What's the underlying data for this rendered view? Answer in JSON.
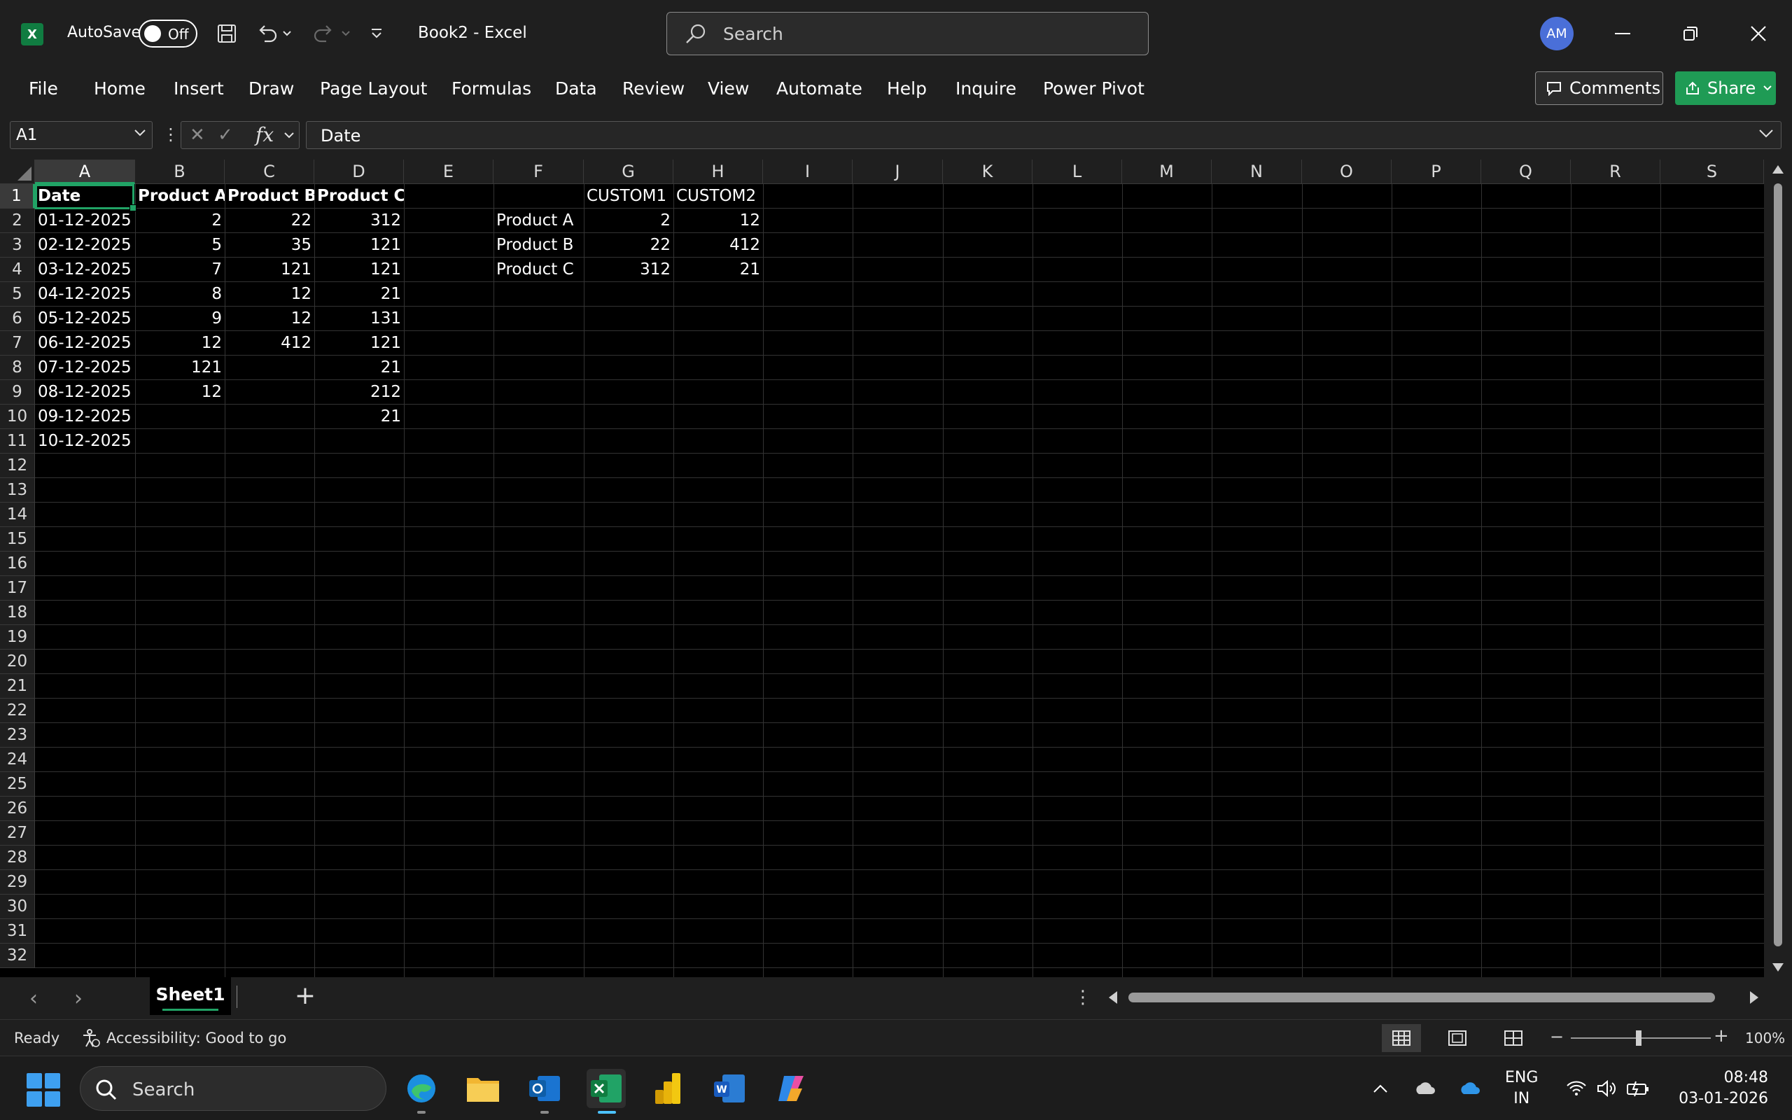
{
  "app": {
    "logo_letter": "X",
    "autosave_label": "AutoSave",
    "autosave_state": "Off",
    "doc_title": "Book2  -  Excel",
    "search_placeholder": "Search",
    "avatar_initials": "AM",
    "accent": "#21a366"
  },
  "menu": {
    "items": [
      "File",
      "Home",
      "Insert",
      "Draw",
      "Page Layout",
      "Formulas",
      "Data",
      "Review",
      "View",
      "Automate",
      "Help",
      "Inquire",
      "Power Pivot"
    ],
    "comments_label": "Comments",
    "share_label": "Share"
  },
  "formula_bar": {
    "name_box": "A1",
    "fx_label": "fx",
    "content": "Date"
  },
  "grid": {
    "columns": [
      "A",
      "B",
      "C",
      "D",
      "E",
      "F",
      "G",
      "H",
      "I",
      "J",
      "K",
      "L",
      "M",
      "N",
      "O",
      "P",
      "Q",
      "R",
      "S"
    ],
    "rows": [
      "1",
      "2",
      "3",
      "4",
      "5",
      "6",
      "7",
      "8",
      "9",
      "10",
      "11",
      "12",
      "13",
      "14",
      "15",
      "16",
      "17",
      "18",
      "19",
      "20",
      "21",
      "22",
      "23",
      "24",
      "25",
      "26",
      "27",
      "28",
      "29",
      "30",
      "31",
      "32"
    ],
    "selected_column": "A",
    "selected_row": "1",
    "table1_headers": [
      "Date",
      "Product A",
      "Product B",
      "Product C"
    ],
    "table1_rows": [
      [
        "01-12-2025",
        "2",
        "22",
        "312"
      ],
      [
        "02-12-2025",
        "5",
        "35",
        "121"
      ],
      [
        "03-12-2025",
        "7",
        "121",
        "121"
      ],
      [
        "04-12-2025",
        "8",
        "12",
        "21"
      ],
      [
        "05-12-2025",
        "9",
        "12",
        "131"
      ],
      [
        "06-12-2025",
        "12",
        "412",
        "121"
      ],
      [
        "07-12-2025",
        "121",
        "",
        "21"
      ],
      [
        "08-12-2025",
        "12",
        "",
        "212"
      ],
      [
        "09-12-2025",
        "",
        "",
        "21"
      ],
      [
        "10-12-2025",
        "",
        "",
        ""
      ]
    ],
    "table2_headers": [
      "",
      "CUSTOM1",
      "CUSTOM2"
    ],
    "table2_rows": [
      [
        "Product A",
        "2",
        "12"
      ],
      [
        "Product B",
        "22",
        "412"
      ],
      [
        "Product C",
        "312",
        "21"
      ]
    ]
  },
  "sheets": {
    "tabs": [
      "Sheet1"
    ],
    "active": "Sheet1"
  },
  "status": {
    "ready": "Ready",
    "accessibility": "Accessibility: Good to go",
    "zoom": "100%"
  },
  "taskbar": {
    "search_label": "Search",
    "lang_line1": "ENG",
    "lang_line2": "IN",
    "time": "08:48",
    "date": "03-01-2026"
  }
}
